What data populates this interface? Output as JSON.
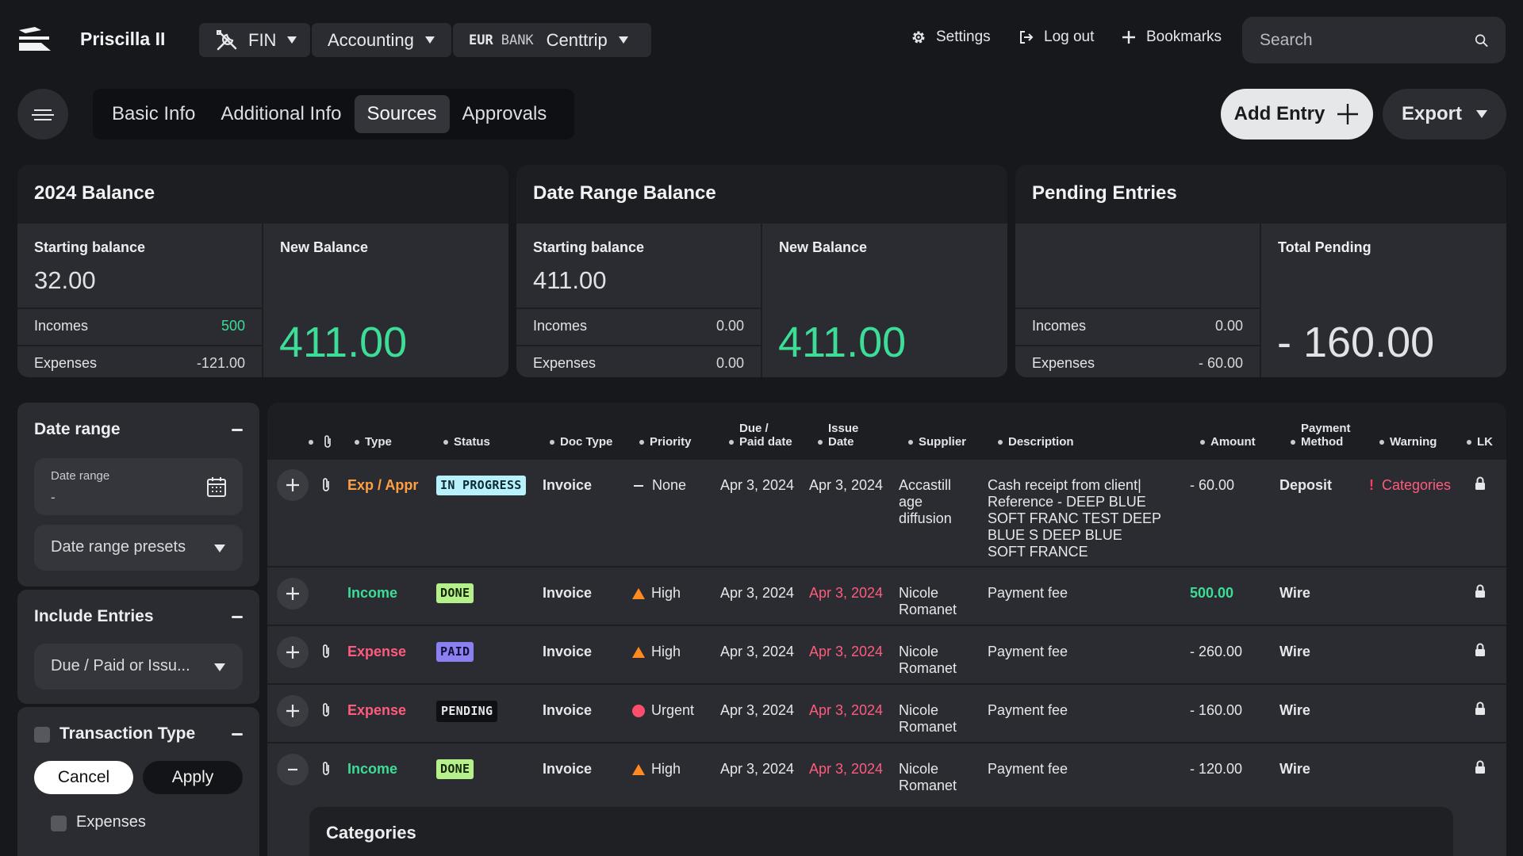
{
  "header": {
    "app_title": "Priscilla II",
    "fin_label": "FIN",
    "accounting_label": "Accounting",
    "bank": {
      "currency": "EUR",
      "type": "BANK",
      "name": "Centtrip"
    },
    "settings_label": "Settings",
    "logout_label": "Log out",
    "bookmarks_label": "Bookmarks",
    "search_placeholder": "Search"
  },
  "tabs": [
    {
      "label": "Basic Info",
      "active": false
    },
    {
      "label": "Additional Info",
      "active": false
    },
    {
      "label": "Sources",
      "active": true
    },
    {
      "label": "Approvals",
      "active": false
    }
  ],
  "actions": {
    "add_entry": "Add Entry",
    "export": "Export"
  },
  "cards": [
    {
      "title": "2024 Balance",
      "starting_label": "Starting balance",
      "starting_value": "32.00",
      "incomes_label": "Incomes",
      "incomes_value": "500",
      "expenses_label": "Expenses",
      "expenses_value": "-121.00",
      "new_label": "New Balance",
      "new_value": "411.00"
    },
    {
      "title": "Date Range Balance",
      "starting_label": "Starting balance",
      "starting_value": "411.00",
      "incomes_label": "Incomes",
      "incomes_value": "0.00",
      "expenses_label": "Expenses",
      "expenses_value": "0.00",
      "new_label": "New Balance",
      "new_value": "411.00"
    },
    {
      "title": "Pending Entries",
      "starting_label": "",
      "starting_value": "",
      "incomes_label": "Incomes",
      "incomes_value": "0.00",
      "expenses_label": "Expenses",
      "expenses_value": "- 60.00",
      "new_label": "Total Pending",
      "new_value": "- 160.00"
    }
  ],
  "filters": {
    "date_range_title": "Date range",
    "date_range_field_label": "Date range",
    "date_range_field_value": "-",
    "date_presets": "Date range presets",
    "include_title": "Include Entries",
    "include_value": "Due / Paid or Issu...",
    "transaction_title": "Transaction Type",
    "cancel": "Cancel",
    "apply": "Apply",
    "expenses_option": "Expenses"
  },
  "table": {
    "columns": {
      "type": "Type",
      "status": "Status",
      "doc_type": "Doc Type",
      "priority": "Priority",
      "due_1": "Due /",
      "due_2": "Paid date",
      "issue_1": "Issue",
      "issue_2": "Date",
      "supplier": "Supplier",
      "description": "Description",
      "amount": "Amount",
      "payment_1": "Payment",
      "payment_2": "Method",
      "warning": "Warning",
      "lk": "LK"
    },
    "rows": [
      {
        "expand": "+",
        "type": "Exp / Appr",
        "status": "IN PROGRESS",
        "doc_type": "Invoice",
        "priority": "None",
        "due": "Apr 3, 2024",
        "issue": "Apr 3, 2024",
        "supplier": "Accastill age diffusion",
        "description": "Cash receipt from client| Reference - DEEP BLUE SOFT FRANC TEST DEEP BLUE S DEEP BLUE SOFT FRANCE",
        "amount": "- 60.00",
        "payment": "Deposit",
        "warning": "Categories"
      },
      {
        "expand": "+",
        "type": "Income",
        "status": "DONE",
        "doc_type": "Invoice",
        "priority": "High",
        "due": "Apr 3, 2024",
        "issue": "Apr 3, 2024",
        "supplier": "Nicole Romanet",
        "description": "Payment fee",
        "amount": "500.00",
        "payment": "Wire",
        "warning": ""
      },
      {
        "expand": "+",
        "type": "Expense",
        "status": "PAID",
        "doc_type": "Invoice",
        "priority": "High",
        "due": "Apr 3, 2024",
        "issue": "Apr 3, 2024",
        "supplier": "Nicole Romanet",
        "description": "Payment fee",
        "amount": "- 260.00",
        "payment": "Wire",
        "warning": ""
      },
      {
        "expand": "+",
        "type": "Expense",
        "status": "PENDING",
        "doc_type": "Invoice",
        "priority": "Urgent",
        "due": "Apr 3, 2024",
        "issue": "Apr 3, 2024",
        "supplier": "Nicole Romanet",
        "description": "Payment fee",
        "amount": "- 160.00",
        "payment": "Wire",
        "warning": ""
      },
      {
        "expand": "−",
        "type": "Income",
        "status": "DONE",
        "doc_type": "Invoice",
        "priority": "High",
        "due": "Apr 3, 2024",
        "issue": "Apr 3, 2024",
        "supplier": "Nicole Romanet",
        "description": "Payment fee",
        "amount": "- 120.00",
        "payment": "Wire",
        "warning": ""
      }
    ],
    "sub_panel_title": "Categories"
  },
  "colors": {
    "accent_green": "#3ddc97",
    "accent_orange": "#ff9f43",
    "accent_red": "#ff5b7e",
    "background": "#17181b",
    "panel": "#2a2c31"
  }
}
